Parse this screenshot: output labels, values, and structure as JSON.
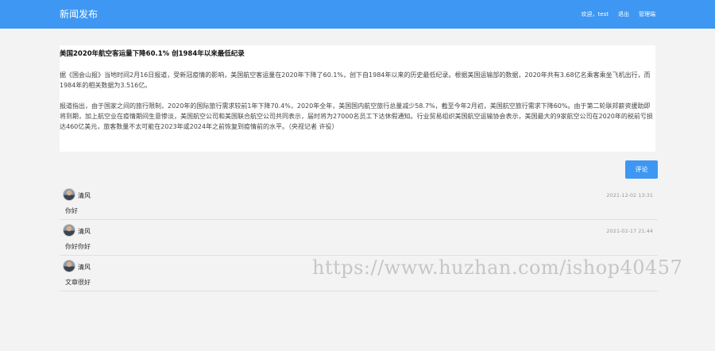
{
  "navbar": {
    "brand": "新闻发布",
    "welcome": "欢迎，test",
    "logout": "退出",
    "admin": "管理端"
  },
  "article": {
    "title": "美国2020年航空客运量下降60.1% 创1984年以来最低纪录",
    "paragraphs": [
      "据《国会山报》当地时间2月16日报道，受新冠疫情的影响，美国航空客运量在2020年下降了60.1%，创下自1984年以来的历史最低纪录。根据美国运输部的数据，2020年共有3.68亿名乘客乘坐飞机出行，而1984年的相关数据为3.516亿。",
      "报道指出，由于国家之间的旅行限制，2020年的国际旅行需求较前1年下降70.4%，2020年全年，美国国内航空旅行总量减少58.7%，截至今年2月初，美国航空旅行需求下降60%。由于第二轮联邦薪资援助即将到期，加上航空业在疫情期间生意惨淡，美国航空公司和美国联合航空公司共同表示，届时将为27000名员工下达休假通知。行业贸易组织美国航空运输协会表示，美国最大的9家航空公司在2020年的税前亏损达460亿美元，旅客数量不太可能在2023年或2024年之前恢复到疫情前的水平。（央视记者 许役）"
    ]
  },
  "comment_button": "评论",
  "comments": [
    {
      "user": "清风",
      "time": "2021-12-02 13:31",
      "content": "你好"
    },
    {
      "user": "清风",
      "time": "2021-02-17 21:44",
      "content": "你好你好"
    },
    {
      "user": "清风",
      "time": "",
      "content": "文章很好"
    }
  ],
  "watermark": "https://www.huzhan.com/ishop40457"
}
